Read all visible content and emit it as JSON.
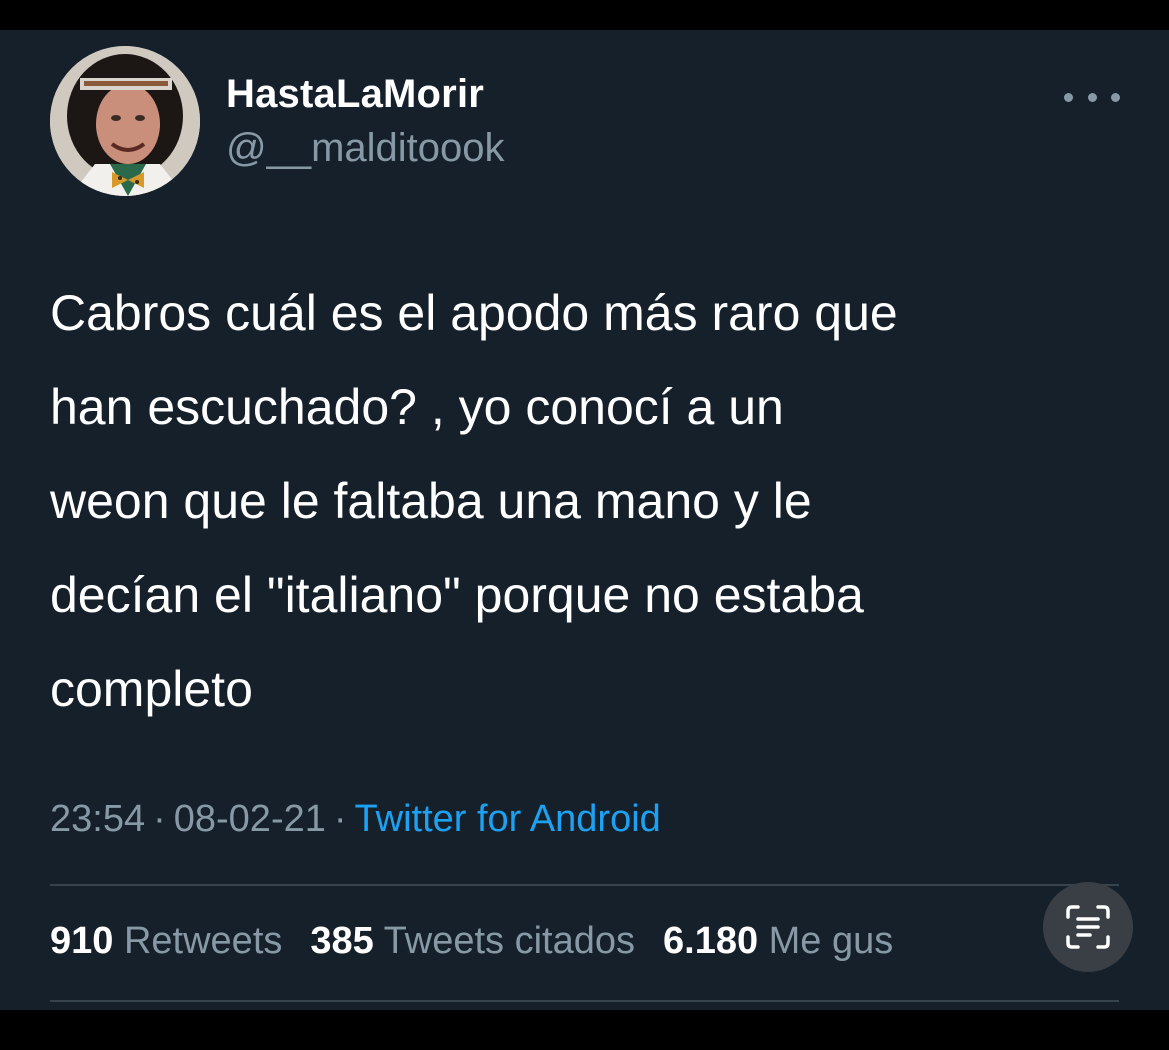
{
  "tweet": {
    "display_name": "HastaLaMorir",
    "handle": "@__malditoook",
    "text_lines": [
      "Cabros cuál es el apodo más raro que",
      "han escuchado? , yo conocí a un",
      "weon que le faltaba una mano y le",
      "decían el \"italiano\" porque no estaba",
      "completo"
    ],
    "time": "23:54",
    "date": "08-02-21",
    "separator": "·",
    "source": "Twitter for Android"
  },
  "stats": {
    "retweets_count": "910",
    "retweets_label": "Retweets",
    "quotes_count": "385",
    "quotes_label": "Tweets citados",
    "likes_count": "6.180",
    "likes_label": "Me gus"
  },
  "icons": {
    "more": "more-horizontal-icon",
    "scan": "live-text-scan-icon"
  },
  "colors": {
    "background": "#15202b",
    "text_primary": "#ffffff",
    "text_secondary": "#8899a6",
    "link": "#1da1f2",
    "divider": "#38444d"
  }
}
